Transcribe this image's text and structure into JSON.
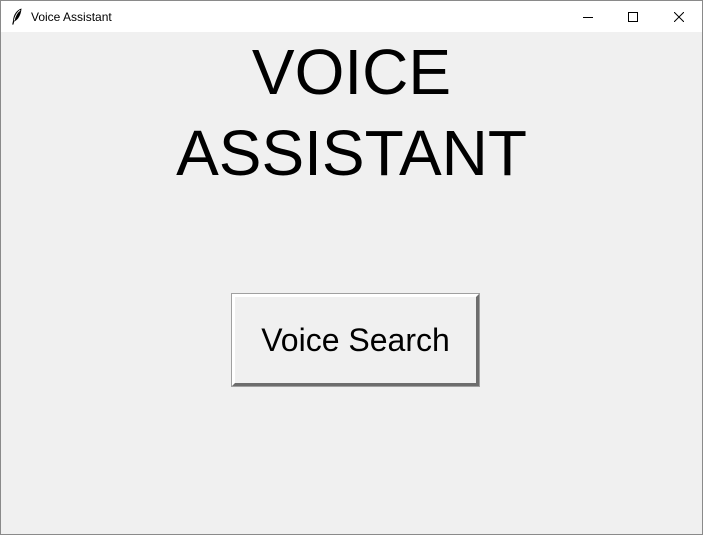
{
  "window": {
    "title": "Voice Assistant",
    "icon": "feather-icon",
    "controls": {
      "minimize": "minimize-icon",
      "maximize": "maximize-icon",
      "close": "close-icon"
    }
  },
  "main": {
    "heading_line1": "VOICE",
    "heading_line2": "ASSISTANT",
    "voice_button_label": "Voice Search"
  },
  "colors": {
    "window_bg": "#f0f0f0",
    "titlebar_bg": "#ffffff",
    "text": "#000000"
  }
}
